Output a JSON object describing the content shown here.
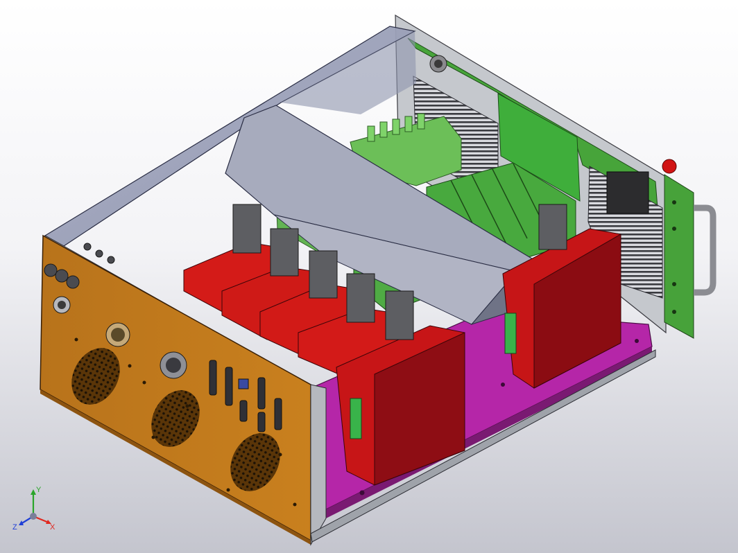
{
  "viewport": {
    "background_top": "#ffffff",
    "background_bottom": "#c4c5ce"
  },
  "model_colors": {
    "front_panel": "#c07a1c",
    "side_panel": "#c4c7cc",
    "glass_cover": "#9aa2bb",
    "pcb_green": "#3da12f",
    "terminal_green": "#6fbf59",
    "drive_red": "#d01515",
    "drive_dark_red": "#8a0c12",
    "base_magenta": "#b526a8",
    "connector_black": "#2a2a2a",
    "handle_gray": "#8a8c90"
  },
  "triad": {
    "x_label": "X",
    "y_label": "Y",
    "z_label": "Z",
    "x_color": "#e0281f",
    "y_color": "#2aa52a",
    "z_color": "#1f3fd6"
  }
}
